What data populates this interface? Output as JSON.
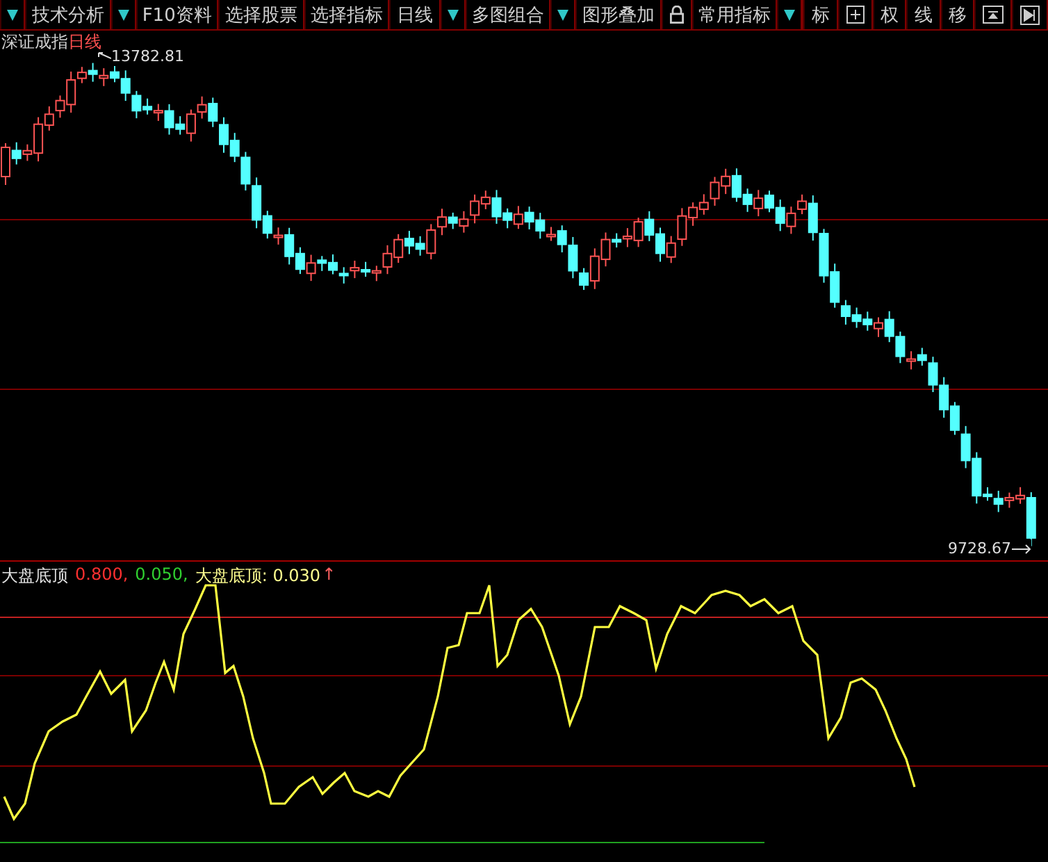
{
  "toolbar": {
    "items": [
      {
        "kind": "arrow"
      },
      {
        "kind": "text",
        "label": "技术分析"
      },
      {
        "kind": "arrow"
      },
      {
        "kind": "text",
        "label": "F10资料"
      },
      {
        "kind": "text",
        "label": "选择股票"
      },
      {
        "kind": "text",
        "label": "选择指标"
      },
      {
        "kind": "text",
        "label": "日线"
      },
      {
        "kind": "arrow"
      },
      {
        "kind": "text",
        "label": "多图组合"
      },
      {
        "kind": "arrow"
      },
      {
        "kind": "text",
        "label": "图形叠加"
      },
      {
        "kind": "lock"
      },
      {
        "kind": "text",
        "label": "常用指标"
      },
      {
        "kind": "arrow"
      },
      {
        "kind": "spacer"
      },
      {
        "kind": "text",
        "label": "标"
      },
      {
        "kind": "grid"
      },
      {
        "kind": "text",
        "label": "权"
      },
      {
        "kind": "text",
        "label": "线"
      },
      {
        "kind": "text",
        "label": "移"
      },
      {
        "kind": "panel"
      },
      {
        "kind": "end"
      }
    ]
  },
  "main_chart": {
    "index_name": "深证成指",
    "period": "日线",
    "high_label": "13782.81",
    "low_label": "9728.67"
  },
  "indicator": {
    "legend": [
      {
        "text": "大盘底顶",
        "color": "#e0e0e0"
      },
      {
        "text": "0.800,",
        "color": "#ff3030"
      },
      {
        "text": "0.050,",
        "color": "#30d030"
      },
      {
        "text": "大盘底顶: 0.030",
        "color": "#ffff90"
      }
    ],
    "trend_arrow": "↑"
  }
}
